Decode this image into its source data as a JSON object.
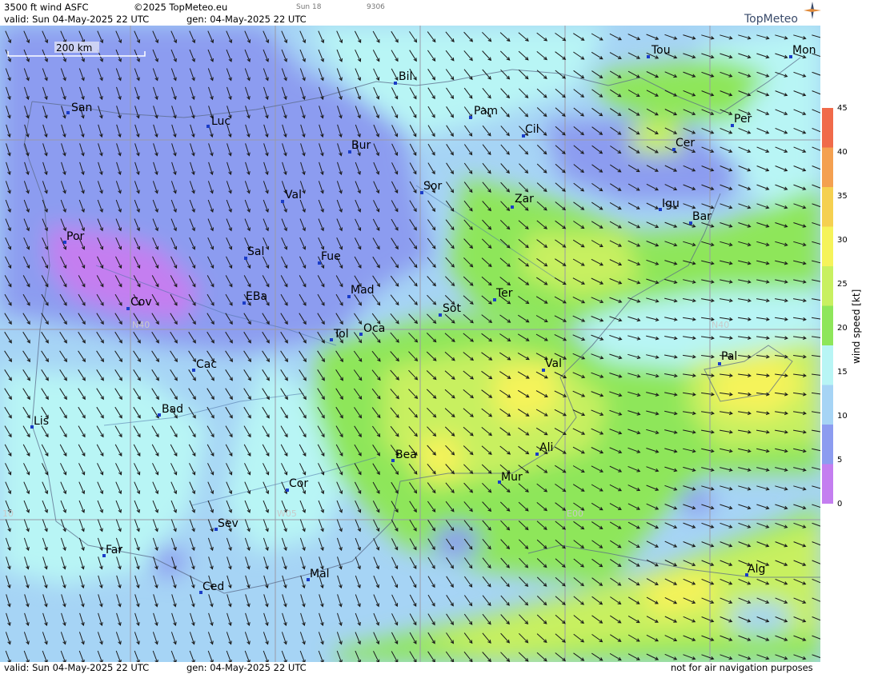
{
  "header": {
    "line1_title": "3500 ft wind ASFC",
    "line1_copyright": "©2025 TopMeteo.eu",
    "line1_day": "Sun 18",
    "line1_code": "9306",
    "line2_valid": "valid:  Sun  04-May-2025  22 UTC",
    "line2_gen": "gen: 04-May-2025  22 UTC"
  },
  "logo": {
    "text": "TopMeteo"
  },
  "scale_bar": {
    "label": "200 km"
  },
  "legend": {
    "title": "wind speed  [kt]",
    "ticks": [
      "45",
      "40",
      "35",
      "30",
      "25",
      "20",
      "15",
      "10",
      "5",
      "0"
    ],
    "colors": [
      "#f06a4a",
      "#f4a050",
      "#f5d050",
      "#f5f35a",
      "#c8f060",
      "#8ee65a",
      "#b8f5f5",
      "#a6d4f5",
      "#8c9cf0",
      "#c47ef0"
    ]
  },
  "grid_labels": [
    "N40",
    "N40",
    "10",
    "W05",
    "E00"
  ],
  "cities": [
    {
      "name": "San"
    },
    {
      "name": "Luc"
    },
    {
      "name": "Bil"
    },
    {
      "name": "Pam"
    },
    {
      "name": "Cil"
    },
    {
      "name": "Tou"
    },
    {
      "name": "Mon"
    },
    {
      "name": "Per"
    },
    {
      "name": "Cer"
    },
    {
      "name": "Bur"
    },
    {
      "name": "Sor"
    },
    {
      "name": "Zar"
    },
    {
      "name": "Igu"
    },
    {
      "name": "Bar"
    },
    {
      "name": "Val"
    },
    {
      "name": "Por"
    },
    {
      "name": "Sal"
    },
    {
      "name": "Fue"
    },
    {
      "name": "Mad"
    },
    {
      "name": "Cov"
    },
    {
      "name": "EBa"
    },
    {
      "name": "Ter"
    },
    {
      "name": "Sot"
    },
    {
      "name": "Tol"
    },
    {
      "name": "Oca"
    },
    {
      "name": "Cac"
    },
    {
      "name": "Val"
    },
    {
      "name": "Pal"
    },
    {
      "name": "Bad"
    },
    {
      "name": "Lis"
    },
    {
      "name": "Bea"
    },
    {
      "name": "Ali"
    },
    {
      "name": "Mur"
    },
    {
      "name": "Cor"
    },
    {
      "name": "Sev"
    },
    {
      "name": "Far"
    },
    {
      "name": "Mal"
    },
    {
      "name": "Ced"
    },
    {
      "name": "Alg"
    }
  ],
  "footer": {
    "valid": "valid:  Sun  04-May-2025  22 UTC",
    "gen": "gen: 04-May-2025  22 UTC",
    "note": "not for air navigation purposes"
  },
  "colors": {
    "very_light": "#c47ef0",
    "light": "#8c9cf0",
    "moderate": "#a6d4f5",
    "fresh": "#b8f5f5",
    "strong": "#8ee65a",
    "stronger": "#c8f060",
    "gale": "#f5f35a"
  }
}
